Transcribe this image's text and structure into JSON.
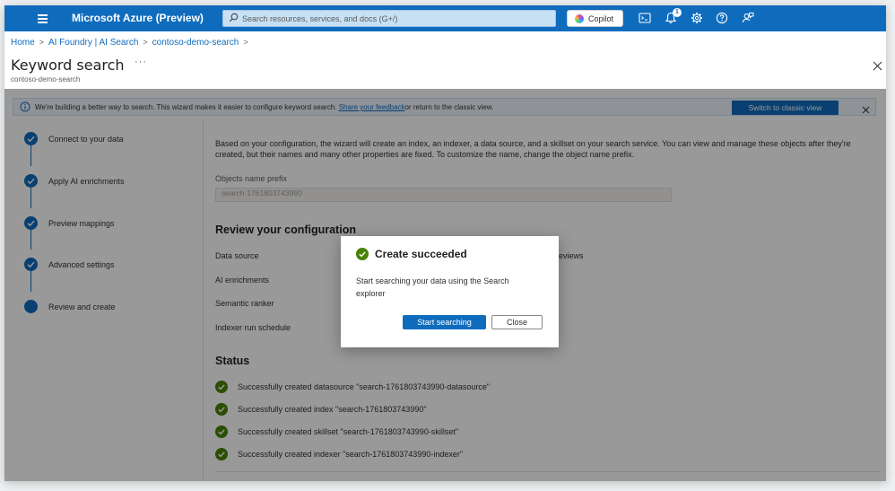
{
  "topbar": {
    "brand": "Microsoft Azure (Preview)",
    "search_placeholder": "Search resources, services, and docs (G+/)",
    "copilot_label": "Copilot",
    "notification_count": "1"
  },
  "breadcrumb": [
    "Home",
    "AI Foundry | AI Search",
    "contoso-demo-search"
  ],
  "page": {
    "title": "Keyword search",
    "more": "···",
    "subtitle": "contoso-demo-search"
  },
  "banner": {
    "text_before": "We're building a better way to search. This wizard makes it easier to configure keyword search. ",
    "link": "Share your feedback",
    "text_after": "or return to the classic view.",
    "button": "Switch to classic view"
  },
  "steps": [
    {
      "label": "Connect to your data",
      "state": "complete"
    },
    {
      "label": "Apply AI enrichments",
      "state": "complete"
    },
    {
      "label": "Preview mappings",
      "state": "complete"
    },
    {
      "label": "Advanced settings",
      "state": "complete"
    },
    {
      "label": "Review and create",
      "state": "current"
    }
  ],
  "main": {
    "intro": "Based on your configuration, the wizard will create an index, an indexer, a data source, and a skillset on your search service. You can view and manage these objects after they're created, but their names and many other properties are fixed. To customize the name, change the object name prefix.",
    "prefix_label": "Objects name prefix",
    "prefix_value": "search-1761803743990",
    "review_heading": "Review your configuration",
    "config": {
      "data_source_label": "Data source",
      "data_source_value": "eviews",
      "ai_enrichments_label": "AI enrichments",
      "semantic_ranker_label": "Semantic ranker",
      "indexer_schedule_label": "Indexer run schedule"
    },
    "status_heading": "Status",
    "status": [
      "Successfully created datasource \"search-1761803743990-datasource\"",
      "Successfully created index \"search-1761803743990\"",
      "Successfully created skillset \"search-1761803743990-skillset\"",
      "Successfully created indexer \"search-1761803743990-indexer\""
    ]
  },
  "dialog": {
    "title": "Create succeeded",
    "body": "Start searching your data using the Search explorer",
    "primary_button": "Start searching",
    "secondary_button": "Close"
  },
  "colors": {
    "azure_blue": "#0f6cbd",
    "success_green": "#498205"
  }
}
